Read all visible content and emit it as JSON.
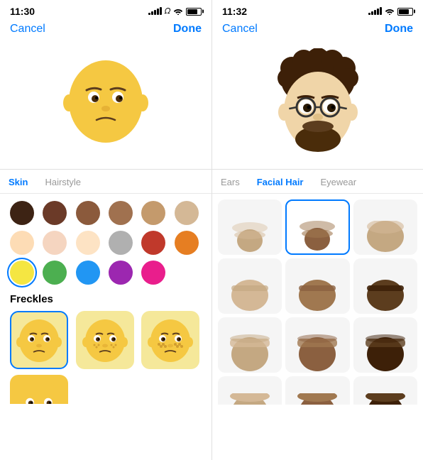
{
  "left_panel": {
    "status": {
      "time": "11:30",
      "signal_bars": [
        3,
        5,
        7,
        9,
        11
      ],
      "battery_level": 75
    },
    "nav": {
      "cancel": "Cancel",
      "done": "Done"
    },
    "avatar_emoji": "🧒",
    "tabs": [
      {
        "label": "Skin",
        "active": true
      },
      {
        "label": "Hairstyle",
        "active": false
      }
    ],
    "skin_colors": [
      {
        "color": "#3D2314",
        "selected": false
      },
      {
        "color": "#6B3A28",
        "selected": false
      },
      {
        "color": "#8B5A3C",
        "selected": false
      },
      {
        "color": "#A0714F",
        "selected": false
      },
      {
        "color": "#C49A6C",
        "selected": false
      },
      {
        "color": "#D4B896",
        "selected": false
      },
      {
        "color": "#E8C49A",
        "selected": false
      },
      {
        "color": "#F5D5AA",
        "selected": false
      },
      {
        "color": "#FDDCB5",
        "selected": false
      },
      {
        "color": "#B0B0B0",
        "selected": false
      },
      {
        "color": "#C0392B",
        "selected": false
      },
      {
        "color": "#E67E22",
        "selected": false
      },
      {
        "color": "#F5E642",
        "selected": true
      },
      {
        "color": "#4CAF50",
        "selected": false
      },
      {
        "color": "#2196F3",
        "selected": false
      },
      {
        "color": "#9C27B0",
        "selected": false
      },
      {
        "color": "#E91E8C",
        "selected": false
      }
    ],
    "freckles_label": "Freckles",
    "freckles": [
      {
        "emoji": "😊",
        "selected": true
      },
      {
        "emoji": "😊",
        "freckles": true,
        "selected": false
      },
      {
        "emoji": "😊",
        "freckles2": true,
        "selected": false
      }
    ]
  },
  "right_panel": {
    "status": {
      "time": "11:32",
      "signal_bars": [
        3,
        5,
        7,
        9,
        11
      ],
      "battery_level": 75
    },
    "nav": {
      "cancel": "Cancel",
      "done": "Done"
    },
    "tabs": [
      {
        "label": "Ears",
        "active": false
      },
      {
        "label": "Facial Hair",
        "active": true
      },
      {
        "label": "Eyewear",
        "active": false
      }
    ],
    "beard_rows": [
      [
        {
          "type": "goatee-light",
          "selected": false
        },
        {
          "type": "goatee-medium",
          "selected": true
        },
        {
          "type": "goatee-full",
          "selected": false
        }
      ],
      [
        {
          "type": "full-light",
          "selected": false
        },
        {
          "type": "full-medium",
          "selected": false
        },
        {
          "type": "full-dark",
          "selected": false
        }
      ],
      [
        {
          "type": "heavy-light",
          "selected": false
        },
        {
          "type": "heavy-medium",
          "selected": false
        },
        {
          "type": "heavy-dark",
          "selected": false
        }
      ],
      [
        {
          "type": "extra-light",
          "selected": false
        },
        {
          "type": "extra-medium",
          "selected": false
        },
        {
          "type": "extra-dark",
          "selected": false
        }
      ]
    ]
  }
}
